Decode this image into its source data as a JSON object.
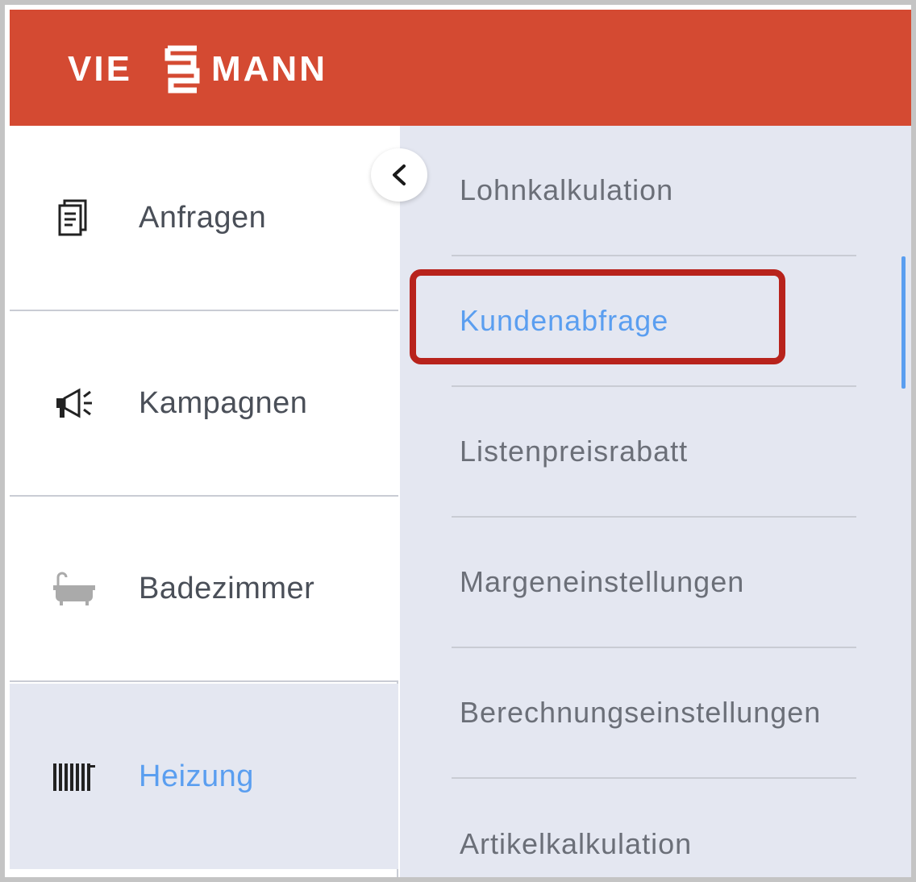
{
  "brand": {
    "logo_text": "VIESSMANN",
    "header_color": "#d44a32"
  },
  "sidebar": {
    "items": [
      {
        "label": "Anfragen",
        "icon": "document-icon",
        "active": false
      },
      {
        "label": "Kampagnen",
        "icon": "megaphone-icon",
        "active": false
      },
      {
        "label": "Badezimmer",
        "icon": "bathtub-icon",
        "active": false
      },
      {
        "label": "Heizung",
        "icon": "radiator-icon",
        "active": true
      }
    ],
    "collapse_icon": "chevron-left-icon"
  },
  "submenu": {
    "items": [
      {
        "label": "Lohnkalkulation",
        "active": false
      },
      {
        "label": "Kundenabfrage",
        "active": true
      },
      {
        "label": "Listenpreisrabatt",
        "active": false
      },
      {
        "label": "Margeneinstellungen",
        "active": false
      },
      {
        "label": "Berechnungseinstellungen",
        "active": false
      },
      {
        "label": "Artikelkalkulation",
        "active": false
      }
    ],
    "highlighted": "Kundenabfrage",
    "highlight_color": "#b8231c",
    "active_color": "#5a9ef0"
  }
}
